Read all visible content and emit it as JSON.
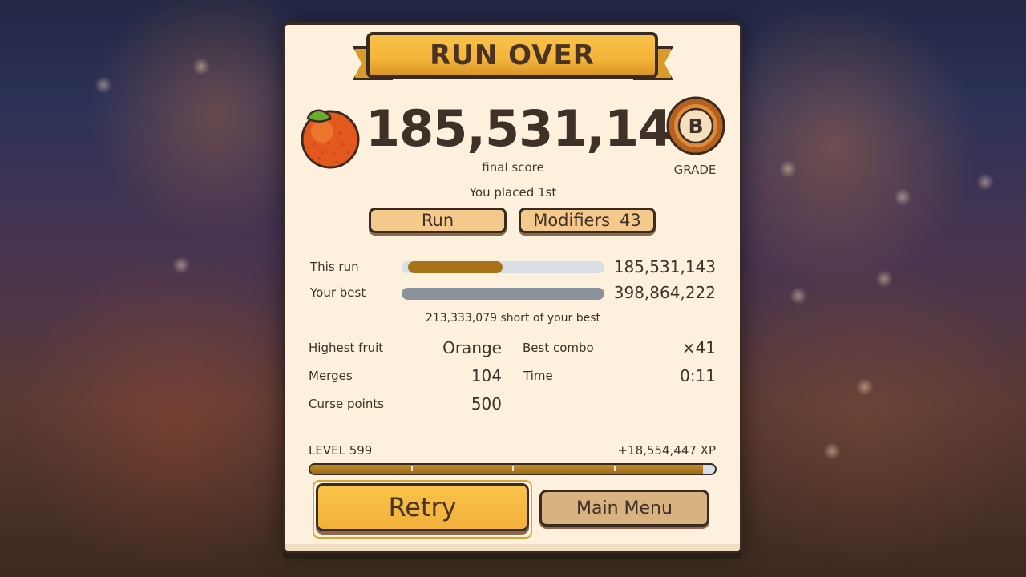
{
  "banner": {
    "title": "RUN OVER"
  },
  "score": {
    "value": "185,531,143",
    "label": "final score"
  },
  "grade": {
    "letter": "B",
    "label": "GRADE"
  },
  "fruit_icon": "orange-icon",
  "placement": "You placed 1st",
  "tabs": {
    "run_label": "Run",
    "modifiers_label": "Modifiers",
    "modifiers_count": "43"
  },
  "comparison": {
    "this_run": {
      "label": "This run",
      "value": "185,531,143",
      "fraction": 0.465
    },
    "your_best": {
      "label": "Your best",
      "value": "398,864,222",
      "fraction": 1.0
    },
    "short_text": "213,333,079 short of your best"
  },
  "stats": {
    "highest_fruit": {
      "label": "Highest fruit",
      "value": "Orange"
    },
    "best_combo": {
      "label": "Best combo",
      "value": "×41"
    },
    "merges": {
      "label": "Merges",
      "value": "104"
    },
    "time": {
      "label": "Time",
      "value": "0:11"
    },
    "curse_points": {
      "label": "Curse points",
      "value": "500"
    }
  },
  "level": {
    "label": "LEVEL 599",
    "xp_gain": "+18,554,447 XP",
    "progress": 0.97
  },
  "buttons": {
    "retry": "Retry",
    "main_menu": "Main Menu"
  },
  "colors": {
    "accent": "#f3b43a",
    "run_bar": "#a87219",
    "best_bar": "#8a929b",
    "panel": "#fdf0dd",
    "ink": "#3f3128"
  }
}
